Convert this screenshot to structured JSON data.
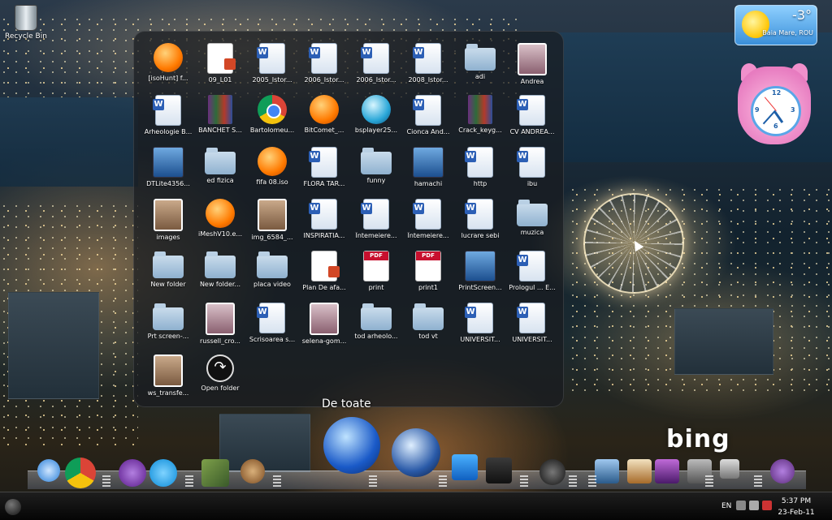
{
  "desktop": {
    "recycle_bin_label": "Recycle Bin",
    "bing_logo_text": "bing"
  },
  "stack": {
    "title": "De toate",
    "items": [
      {
        "label": "[isoHunt] f...",
        "icon": "orange-app-icon"
      },
      {
        "label": "09_L01",
        "icon": "powerpoint-icon"
      },
      {
        "label": "2005_Istor...",
        "icon": "word-doc-icon"
      },
      {
        "label": "2006_Istor...",
        "icon": "word-doc-icon"
      },
      {
        "label": "2006_Istor...",
        "icon": "word-doc-icon"
      },
      {
        "label": "2008_Istor...",
        "icon": "word-doc-icon"
      },
      {
        "label": "adi",
        "icon": "folder-icon"
      },
      {
        "label": "Andrea",
        "icon": "photo-icon"
      },
      {
        "label": "Arheologie B...",
        "icon": "word-doc-icon"
      },
      {
        "label": "BANCHET S...",
        "icon": "winrar-icon"
      },
      {
        "label": "Bartolomeu...",
        "icon": "chrome-icon"
      },
      {
        "label": "BitComet_...",
        "icon": "orange-app-icon"
      },
      {
        "label": "bsplayer25...",
        "icon": "bsplayer-icon"
      },
      {
        "label": "Cionca And...",
        "icon": "word-doc-icon"
      },
      {
        "label": "Crack_keyg...",
        "icon": "winrar-icon"
      },
      {
        "label": "CV ANDREA...",
        "icon": "word-doc-icon"
      },
      {
        "label": "DTLite4356...",
        "icon": "setup-icon"
      },
      {
        "label": "ed fizica",
        "icon": "folder-icon"
      },
      {
        "label": "fifa 08.iso",
        "icon": "orange-app-icon"
      },
      {
        "label": "FLORA TAR...",
        "icon": "word-doc-icon"
      },
      {
        "label": "funny",
        "icon": "folder-icon"
      },
      {
        "label": "hamachi",
        "icon": "setup-icon"
      },
      {
        "label": "http",
        "icon": "word-doc-icon"
      },
      {
        "label": "ibu",
        "icon": "word-doc-icon"
      },
      {
        "label": "images",
        "icon": "photo-icon"
      },
      {
        "label": "iMeshV10.e...",
        "icon": "orange-app-icon"
      },
      {
        "label": "img_6584_...",
        "icon": "photo-icon"
      },
      {
        "label": "INSPIRATIA...",
        "icon": "word-doc-icon"
      },
      {
        "label": "Întemeiere...",
        "icon": "word-doc-icon"
      },
      {
        "label": "Întemeiere...",
        "icon": "word-doc-icon"
      },
      {
        "label": "lucrare sebi",
        "icon": "word-doc-icon"
      },
      {
        "label": "muzica",
        "icon": "folder-icon"
      },
      {
        "label": "New folder",
        "icon": "folder-icon"
      },
      {
        "label": "New folder...",
        "icon": "folder-icon"
      },
      {
        "label": "placa video",
        "icon": "folder-icon"
      },
      {
        "label": "Plan De afa...",
        "icon": "powerpoint-icon"
      },
      {
        "label": "print",
        "icon": "pdf-icon"
      },
      {
        "label": "print1",
        "icon": "pdf-icon"
      },
      {
        "label": "PrintScreen...",
        "icon": "setup-icon"
      },
      {
        "label": "Prologul ... E...",
        "icon": "word-doc-icon"
      },
      {
        "label": "Prt screen-...",
        "icon": "folder-icon"
      },
      {
        "label": "russell_cro...",
        "icon": "photo-icon"
      },
      {
        "label": "Scrisoarea s...",
        "icon": "word-doc-icon"
      },
      {
        "label": "selena-gom...",
        "icon": "photo-icon"
      },
      {
        "label": "tod arheolo...",
        "icon": "folder-icon"
      },
      {
        "label": "tod vt",
        "icon": "folder-icon"
      },
      {
        "label": "UNIVERSIT...",
        "icon": "word-doc-icon"
      },
      {
        "label": "UNIVERSIT...",
        "icon": "word-doc-icon"
      },
      {
        "label": "ws_transfe...",
        "icon": "photo-icon"
      },
      {
        "label": "Open folder",
        "icon": "open-folder-icon"
      }
    ]
  },
  "weather": {
    "temperature": "-3°",
    "location": "Baia Mare, ROU",
    "condition_icon": "sun-icon"
  },
  "clock_gadget": {
    "numbers": [
      "12",
      "3",
      "6",
      "9"
    ]
  },
  "dock": {
    "items": [
      "safari-icon",
      "chrome-icon",
      "yahoo-messenger-icon",
      "skype-icon",
      "games-icon",
      "emule-icon",
      "network-globe-icon",
      "media-player-icon",
      "itunes-icon",
      "movie-icon",
      "film-reel-icon",
      "monitor-icon",
      "home-icon",
      "photos-icon",
      "system-preferences-icon",
      "trash-icon",
      "messenger-bird-icon"
    ]
  },
  "taskbar": {
    "language": "EN",
    "time": "5:37 PM",
    "date": "23-Feb-11"
  },
  "colors": {
    "stack_background": "#191c20",
    "taskbar": "#050505",
    "accent_blue": "#1d5fa8"
  }
}
